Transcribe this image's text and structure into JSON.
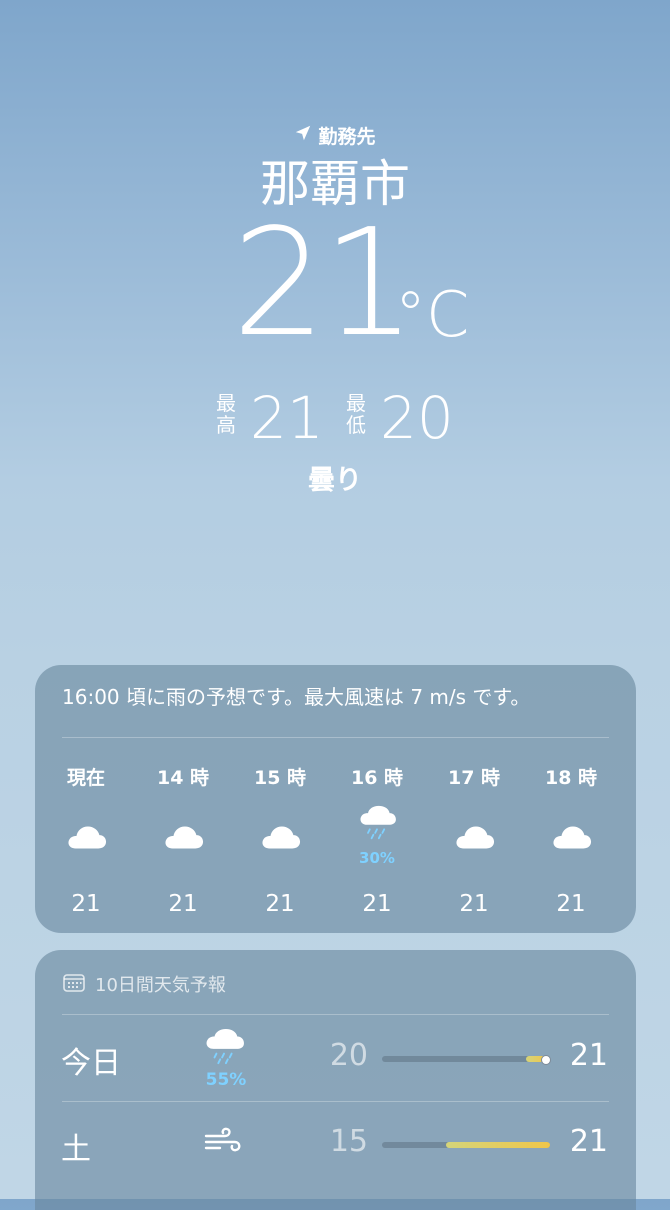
{
  "header": {
    "location_label": "勤務先",
    "city": "那覇市",
    "temperature": "21",
    "unit": "°C",
    "high_label": "最高",
    "high": "21",
    "low_label": "最低",
    "low": "20",
    "condition": "曇り"
  },
  "hourly": {
    "summary": "16:00 頃に雨の予想です。最大風速は 7 m/s です。",
    "items": [
      {
        "time": "現在",
        "icon": "cloud-icon",
        "temp": "21",
        "precip": ""
      },
      {
        "time": "14 時",
        "icon": "cloud-icon",
        "temp": "21",
        "precip": ""
      },
      {
        "time": "15 時",
        "icon": "cloud-icon",
        "temp": "21",
        "precip": ""
      },
      {
        "time": "16 時",
        "icon": "cloud-rain-icon",
        "temp": "21",
        "precip": "30%"
      },
      {
        "time": "17 時",
        "icon": "cloud-icon",
        "temp": "21",
        "precip": ""
      },
      {
        "time": "18 時",
        "icon": "cloud-icon",
        "temp": "21",
        "precip": ""
      }
    ]
  },
  "daily": {
    "title": "10日間天気予報",
    "items": [
      {
        "day": "今日",
        "icon": "cloud-rain-icon",
        "precip": "55%",
        "low": "20",
        "high": "21",
        "bar_start": 0.86,
        "bar_end": 0.98,
        "current": 0.97
      },
      {
        "day": "土",
        "icon": "wind-icon",
        "precip": "",
        "low": "15",
        "high": "21",
        "bar_start": 0.38,
        "bar_end": 1.0,
        "current": null
      }
    ]
  },
  "colors": {
    "precip": "#7fd1ff",
    "card_bg": "rgba(105,135,158,0.62)",
    "bar_warm": "#f0c64a"
  }
}
